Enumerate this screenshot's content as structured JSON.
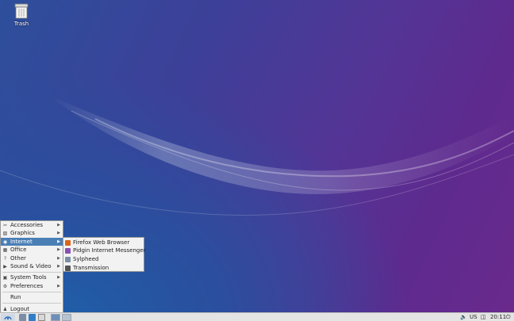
{
  "desktop": {
    "icons": [
      {
        "label": "Trash",
        "icon": "trash-icon"
      }
    ]
  },
  "menu": {
    "items": [
      {
        "label": "Accessories",
        "icon": "accessories-icon",
        "submenu": true
      },
      {
        "label": "Graphics",
        "icon": "graphics-icon",
        "submenu": true
      },
      {
        "label": "Internet",
        "icon": "internet-icon",
        "submenu": true,
        "selected": true
      },
      {
        "label": "Office",
        "icon": "office-icon",
        "submenu": true
      },
      {
        "label": "Other",
        "icon": "other-icon",
        "submenu": true
      },
      {
        "label": "Sound & Video",
        "icon": "sound-video-icon",
        "submenu": true
      },
      {
        "label": "System Tools",
        "icon": "system-tools-icon",
        "submenu": true
      },
      {
        "label": "Preferences",
        "icon": "preferences-icon",
        "submenu": true
      },
      {
        "label": "Run",
        "icon": "",
        "submenu": false
      },
      {
        "label": "Logout",
        "icon": "logout-icon",
        "submenu": false
      }
    ]
  },
  "submenu": {
    "items": [
      {
        "label": "Firefox Web Browser",
        "icon": "firefox-icon",
        "color": "#d9651c"
      },
      {
        "label": "Pidgin Internet Messenger",
        "icon": "pidgin-icon",
        "color": "#8a4fb4"
      },
      {
        "label": "Sylpheed",
        "icon": "sylpheed-icon",
        "color": "#7a8ea6"
      },
      {
        "label": "Transmission",
        "icon": "transmission-icon",
        "color": "#555555"
      }
    ]
  },
  "taskbar": {
    "keyboard_layout": "US",
    "clock": "20:11"
  },
  "colors": {
    "selection": "#4a7fb6",
    "menu_bg": "#f2f2f2",
    "taskbar_bg": "#e4e4e4"
  }
}
